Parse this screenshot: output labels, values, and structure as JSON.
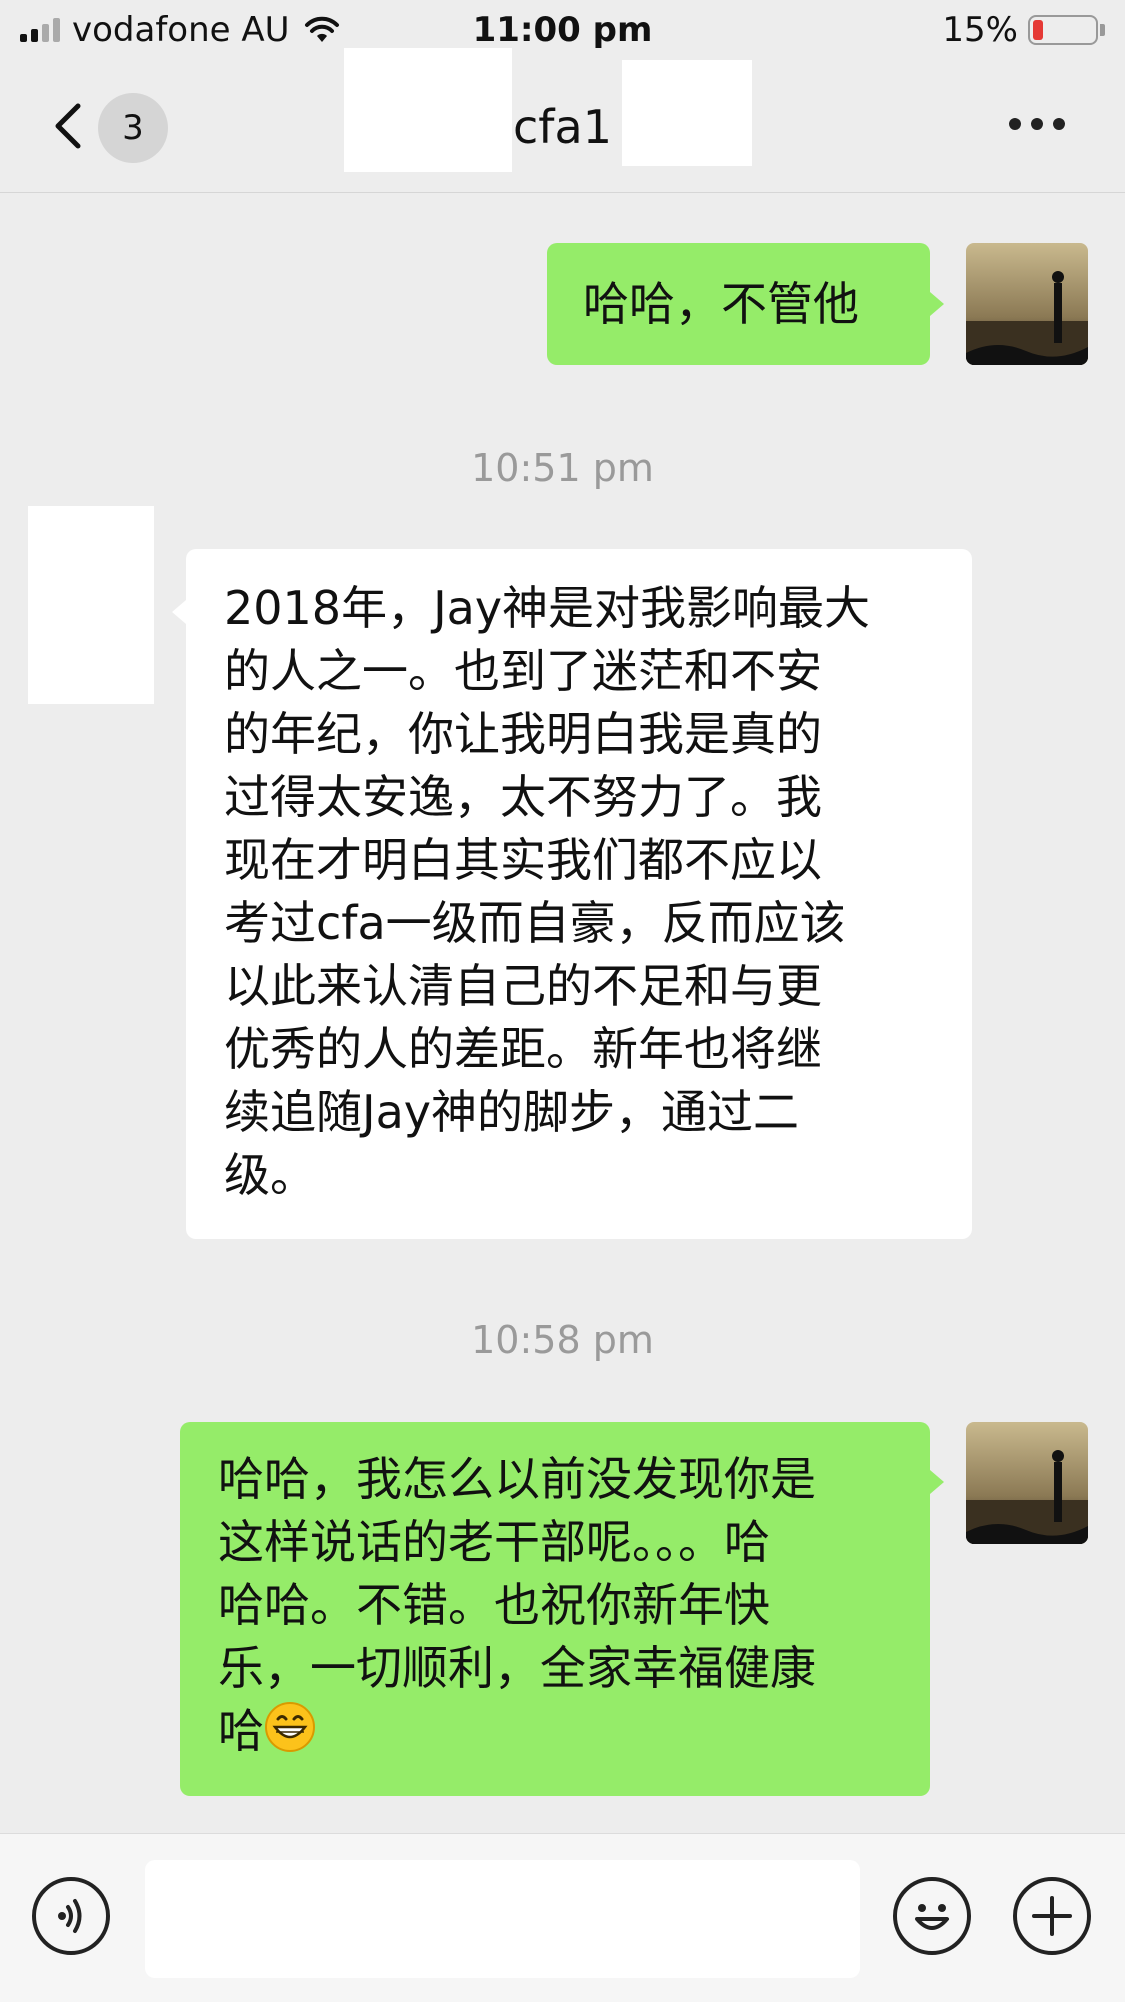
{
  "status_bar": {
    "carrier": "vodafone AU",
    "time": "11:00 pm",
    "battery_percent": "15%",
    "battery_level": 0.15
  },
  "nav": {
    "back_badge": "3",
    "title": "cfa1",
    "more_icon": "more-dots-icon"
  },
  "messages": [
    {
      "side": "right",
      "text": "哈哈，不管他"
    },
    {
      "timestamp": "10:51 pm"
    },
    {
      "side": "left",
      "lines": [
        "2018年，Jay神是对我影响最大",
        "的人之一。也到了迷茫和不安",
        "的年纪，你让我明白我是真的",
        "过得太安逸，太不努力了。我",
        "现在才明白其实我们都不应以",
        "考过cfa一级而自豪，反而应该",
        "以此来认清自己的不足和与更",
        "优秀的人的差距。新年也将继",
        "续追随Jay神的脚步，通过二",
        "级。"
      ]
    },
    {
      "timestamp": "10:58 pm"
    },
    {
      "side": "right",
      "lines": [
        "哈哈，我怎么以前没发现你是",
        "这样说话的老干部呢。。。哈",
        "哈哈。不错。也祝你新年快",
        "乐，一切顺利，全家幸福健康",
        "哈"
      ],
      "emoji": "grinning-face-icon"
    }
  ],
  "colors": {
    "background": "#ededed",
    "sent_bubble": "#95ec69",
    "received_bubble": "#ffffff",
    "timestamp": "#9a9a9a"
  },
  "input_bar": {
    "left_icon": "voice-icon",
    "emoji_icon": "emoji-icon",
    "plus_icon": "plus-icon"
  }
}
